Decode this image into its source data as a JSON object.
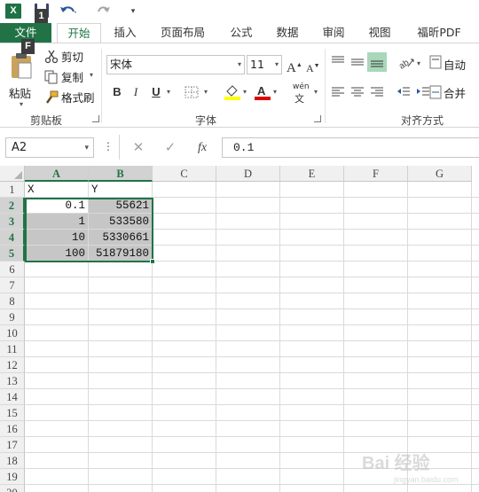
{
  "app": {
    "logo_text": "X"
  },
  "key_tips": {
    "save": "1",
    "file": "F"
  },
  "ribbon_tabs": [
    "文件",
    "开始",
    "插入",
    "页面布局",
    "公式",
    "数据",
    "审阅",
    "视图",
    "福昕PDF"
  ],
  "active_tab": "开始",
  "clipboard": {
    "paste": "粘贴",
    "cut": "剪切",
    "copy": "复制",
    "format_painter": "格式刷",
    "group_label": "剪贴板"
  },
  "font": {
    "name": "宋体",
    "size": "11",
    "bold": "B",
    "italic": "I",
    "underline": "U",
    "grow": "A",
    "shrink": "A",
    "phonetic": "wén",
    "group_label": "字体"
  },
  "alignment": {
    "wrap_text": "自动",
    "merge": "合并",
    "group_label": "对齐方式"
  },
  "formula_bar": {
    "name_box": "A2",
    "cancel": "✕",
    "enter": "✓",
    "fx": "fx",
    "formula": "0.1"
  },
  "sheet": {
    "columns": [
      "A",
      "B",
      "C",
      "D",
      "E",
      "F",
      "G"
    ],
    "selected_columns": [
      "A",
      "B"
    ],
    "rows": [
      "1",
      "2",
      "3",
      "4",
      "5",
      "6",
      "7",
      "8",
      "9",
      "10",
      "11",
      "12",
      "13",
      "14",
      "15",
      "16",
      "17",
      "18",
      "19",
      "20"
    ],
    "selected_rows": [
      "2",
      "3",
      "4",
      "5"
    ],
    "cells": {
      "A1": "X",
      "B1": "Y",
      "A2": "0.1",
      "B2": "55621",
      "A3": "1",
      "B3": "533580",
      "A4": "10",
      "B4": "5330661",
      "A5": "100",
      "B5": "51879180"
    },
    "active_cell": "A2",
    "selection": "A2:B5"
  },
  "watermark": {
    "text": "Bai 经验",
    "sub": "jingyan.baidu.com"
  },
  "colors": {
    "excel_green": "#217346",
    "selection_fill": "#c6c6c6",
    "header_fill": "#f0f0f0"
  }
}
